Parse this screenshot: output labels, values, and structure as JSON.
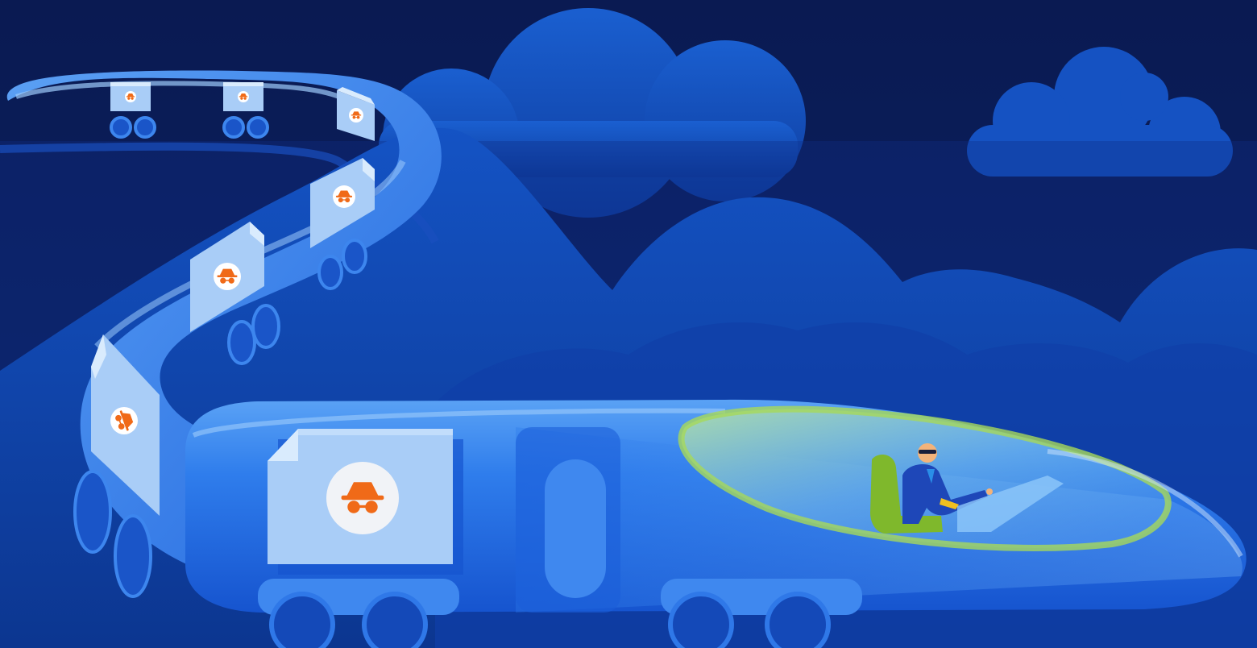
{
  "scene": {
    "description_visible_text": "",
    "colors": {
      "sky": "#0b1d5a",
      "hills_dark": "#0d3a9c",
      "hills_mid": "#0f47b8",
      "cloud": "#1656c7",
      "train_body": "#1f6de6",
      "train_light": "#4f98f2",
      "train_highlight": "#8ec2fa",
      "window_green": "#b8e86a",
      "accent_orange": "#f06a18",
      "container_face": "#a9cdf7",
      "container_side": "#d9ebfd"
    },
    "icons": [
      "incognito-icon",
      "incognito-icon",
      "incognito-icon",
      "incognito-icon",
      "incognito-icon",
      "incognito-icon",
      "incognito-icon",
      "incognito-icon"
    ]
  }
}
